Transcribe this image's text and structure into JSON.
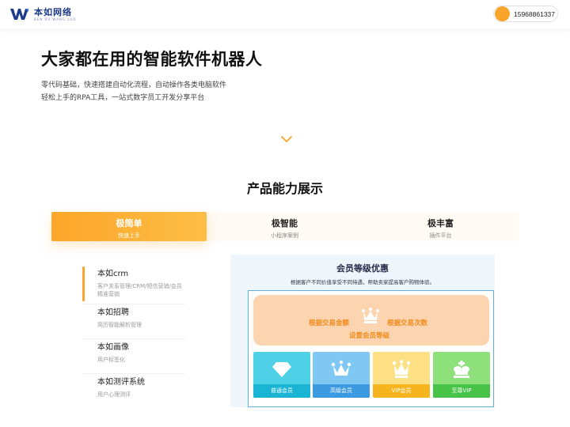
{
  "header": {
    "logo_cn": "本如网络",
    "logo_en": "BEN RU WANG LUO",
    "phone": "15968861337"
  },
  "hero": {
    "title": "大家都在用的智能软件机器人",
    "line1": "零代码基础，快速搭建自动化流程，自动操作各类电脑软件",
    "line2": "轻松上手的RPA工具，一站式数字员工开发分享平台"
  },
  "section": {
    "title": "产品能力展示",
    "tabs": [
      {
        "title": "极简单",
        "sub": "快速上手"
      },
      {
        "title": "极智能",
        "sub": "小程序案例"
      },
      {
        "title": "极丰富",
        "sub": "插件平台"
      }
    ]
  },
  "products": [
    {
      "name": "本如crm",
      "desc1": "客户关系管理/CRM/短信营销/会员",
      "desc2": "精准营销"
    },
    {
      "name": "本如招聘",
      "desc1": "简历智能解析管理"
    },
    {
      "name": "本如画像",
      "desc1": "用户标签化"
    },
    {
      "name": "本如测评系统",
      "desc1": "用户心理测评"
    }
  ],
  "preview": {
    "title": "会员等级优惠",
    "subtitle": "根据客户不同价值享受不同待遇，帮助卖家提高客户购物体验。",
    "banner_left": "根据交易金额",
    "banner_right": "根据交易次数",
    "banner_bottom": "设置会员等级",
    "cards": [
      "普通会员",
      "高级会员",
      "VIP会员",
      "至尊VIP"
    ]
  },
  "colors": {
    "accent": "#f9a52b",
    "brand": "#1d3a8a"
  }
}
